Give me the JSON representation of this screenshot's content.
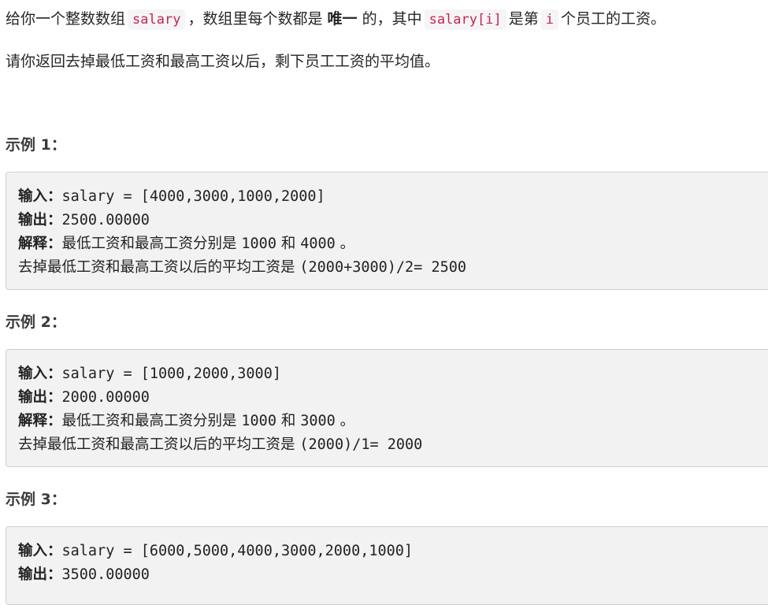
{
  "intro": {
    "p1": {
      "t1": "给你一个整数数组",
      "c1": "salary",
      "t2": "，数组里每个数都是",
      "b1": "唯一",
      "t3": "的，其中",
      "c2": "salary[i]",
      "t4": "是第",
      "c3": "i",
      "t5": "个员工的工资。"
    },
    "p2": "请你返回去掉最低工资和最高工资以后，剩下员工工资的平均值。"
  },
  "examples": [
    {
      "title": "示例 1：",
      "input_label": "输入：",
      "input": "salary = [4000,3000,1000,2000]",
      "output_label": "输出：",
      "output": "2500.00000",
      "explain_label": "解释：",
      "explain_pre": "最低工资和最高工资分别是 ",
      "explain_v1": "1000",
      "explain_and": " 和 ",
      "explain_v2": "4000",
      "explain_end": " 。",
      "explain2_pre": "去掉最低工资和最高工资以后的平均工资是 ",
      "explain2_expr": "(2000+3000)/2= 2500"
    },
    {
      "title": "示例 2：",
      "input_label": "输入：",
      "input": "salary = [1000,2000,3000]",
      "output_label": "输出：",
      "output": "2000.00000",
      "explain_label": "解释：",
      "explain_pre": "最低工资和最高工资分别是 ",
      "explain_v1": "1000",
      "explain_and": " 和 ",
      "explain_v2": "3000",
      "explain_end": " 。",
      "explain2_pre": "去掉最低工资和最高工资以后的平均工资是 ",
      "explain2_expr": "(2000)/1= 2000"
    },
    {
      "title": "示例 3：",
      "input_label": "输入：",
      "input": "salary = [6000,5000,4000,3000,2000,1000]",
      "output_label": "输出：",
      "output": "3500.00000"
    }
  ]
}
